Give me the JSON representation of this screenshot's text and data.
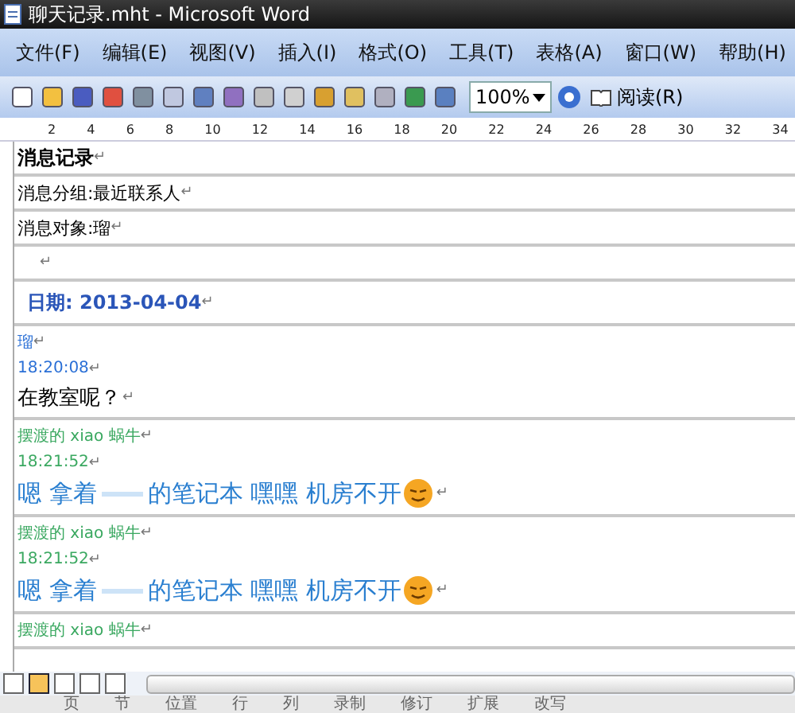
{
  "window": {
    "title": "聊天记录.mht - Microsoft Word"
  },
  "menu": [
    {
      "label": "文件(F)"
    },
    {
      "label": "编辑(E)"
    },
    {
      "label": "视图(V)"
    },
    {
      "label": "插入(I)"
    },
    {
      "label": "格式(O)"
    },
    {
      "label": "工具(T)"
    },
    {
      "label": "表格(A)"
    },
    {
      "label": "窗口(W)"
    },
    {
      "label": "帮助(H)"
    }
  ],
  "toolbar": {
    "zoom": "100%",
    "read_button": "阅读(R)"
  },
  "ruler": [
    "2",
    "4",
    "6",
    "8",
    "10",
    "12",
    "14",
    "16",
    "18",
    "20",
    "22",
    "24",
    "26",
    "28",
    "30",
    "32",
    "34"
  ],
  "header_rows": [
    {
      "text": "消息记录",
      "bold": true,
      "end_mark": "↵"
    },
    {
      "text": "消息分组:最近联系人",
      "bold": false,
      "end_mark": "↵"
    },
    {
      "text": "消息对象:瑠",
      "bold": false,
      "end_mark": "↵"
    },
    {
      "end_mark": "↵"
    }
  ],
  "date_row": {
    "text": "日期: 2013-04-04",
    "end_mark": "↵"
  },
  "messages": [
    {
      "color": "#2a6fd6",
      "sender": "瑠",
      "time": "18:20:08",
      "parts": [
        "在教室呢？"
      ],
      "kind": "plain",
      "emoji": false,
      "marks": [
        "↵",
        "↵",
        "↵"
      ]
    },
    {
      "color": "#3aa860",
      "sender": "摆渡的 xiao 蜗牛",
      "time": "18:21:52",
      "parts": [
        "嗯 拿着",
        "的笔记本  嘿嘿 机房不开"
      ],
      "kind": "large",
      "emoji": true,
      "marks": [
        "↵",
        "↵",
        "↵"
      ]
    },
    {
      "color": "#3aa860",
      "sender": "摆渡的 xiao 蜗牛",
      "time": "18:21:52",
      "parts": [
        "嗯 拿着",
        "的笔记本  嘿嘿 机房不开"
      ],
      "kind": "large",
      "emoji": true,
      "marks": [
        "↵",
        "↵",
        "↵"
      ]
    },
    {
      "color": "#3aa860",
      "sender": "摆渡的 xiao 蜗牛",
      "marks": [
        "↵"
      ]
    }
  ],
  "status_bar": [
    "页",
    "节",
    "位置",
    "行",
    "列",
    "录制",
    "修订",
    "扩展",
    "改写"
  ]
}
